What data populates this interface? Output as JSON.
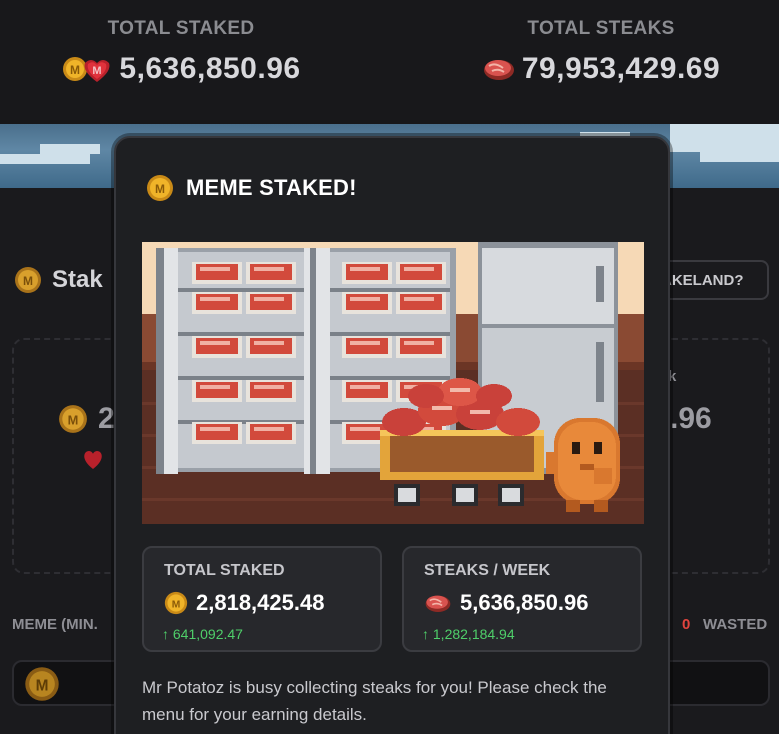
{
  "header": {
    "total_staked": {
      "label": "TOTAL STAKED",
      "value": "5,636,850.96",
      "icon": "meme-coin-heart-icon"
    },
    "total_steaks": {
      "label": "TOTAL STEAKS",
      "value": "79,953,429.69",
      "icon": "steak-icon"
    }
  },
  "background": {
    "section_title": "Stak",
    "pill_label": "AKELAND?",
    "left_value": "2",
    "right_label": "k",
    "right_value": ".96",
    "meme_min_label": "MEME (MIN.",
    "wasted_count": "0",
    "wasted_label": "WASTED"
  },
  "modal": {
    "title": "MEME STAKED!",
    "stats": [
      {
        "label": "TOTAL STAKED",
        "value": "2,818,425.48",
        "delta": "↑ 641,092.47",
        "icon": "meme-coin-icon"
      },
      {
        "label": "STEAKS / WEEK",
        "value": "5,636,850.96",
        "delta": "↑ 1,282,184.94",
        "icon": "steak-icon"
      }
    ],
    "message": "Mr Potatoz is busy collecting steaks for you! Please check the menu for your earning details."
  },
  "colors": {
    "background": "#17171a",
    "modal": "#1e1f22",
    "coin_gold": "#f0b429",
    "steak_red": "#d9534f",
    "positive_green": "#4fcf6a"
  }
}
